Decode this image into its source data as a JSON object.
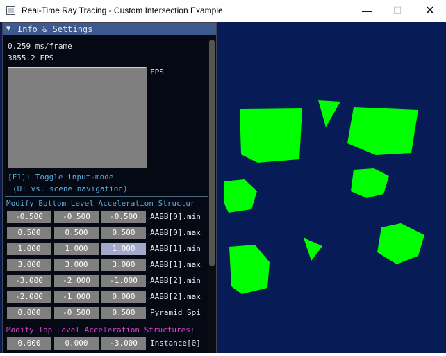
{
  "window": {
    "title": "Real-Time Ray Tracing - Custom Intersection Example",
    "controls": {
      "minimize": "—",
      "maximize": "☐",
      "close": "✕"
    }
  },
  "panel": {
    "header": "Info & Settings",
    "header_icon": "triangle-down-icon",
    "timing": "0.259 ms/frame",
    "fps": "3855.2 FPS",
    "plot_label": "FPS",
    "help_line1": "[F1]: Toggle input-mode",
    "help_line2": "(UI vs. scene navigation)",
    "blas_section": "Modify Bottom Level Acceleration Structur",
    "tlas_section": "Modify Top Level Acceleration Structures:",
    "blas_rows": [
      {
        "values": [
          "-0.500",
          "-0.500",
          "-0.500"
        ],
        "label": "AABB[0].min"
      },
      {
        "values": [
          "0.500",
          "0.500",
          "0.500"
        ],
        "label": "AABB[0].max"
      },
      {
        "values": [
          "1.000",
          "1.000",
          "1.000"
        ],
        "label": "AABB[1].min"
      },
      {
        "values": [
          "3.000",
          "3.000",
          "3.000"
        ],
        "label": "AABB[1].max"
      },
      {
        "values": [
          "-3.000",
          "-2.000",
          "-1.000"
        ],
        "label": "AABB[2].min"
      },
      {
        "values": [
          "-2.000",
          "-1.000",
          "0.000"
        ],
        "label": "AABB[2].max"
      },
      {
        "values": [
          "0.000",
          "-0.500",
          "0.500"
        ],
        "label": "Pyramid Spi"
      }
    ],
    "tlas_rows": [
      {
        "values": [
          "0.000",
          "0.000",
          "-3.000"
        ],
        "label": "Instance[0]"
      }
    ]
  },
  "colors": {
    "scene_background": "#071c56",
    "object_fill": "#00ff00",
    "panel_header": "#3d5a8e",
    "help_text": "#5ba8d8",
    "tlas_section_text": "#e040d0",
    "blas_section_text": "#5ba8d8"
  }
}
